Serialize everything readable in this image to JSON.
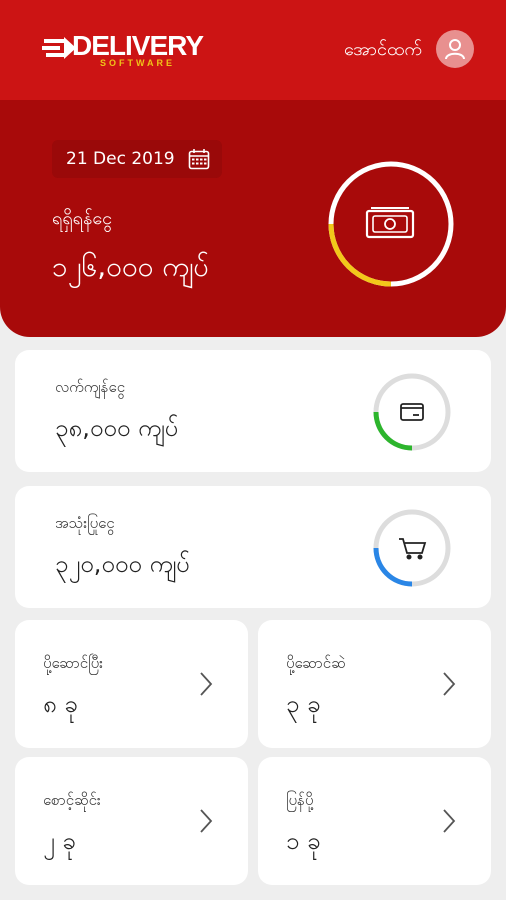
{
  "header": {
    "logo_text": "DELIVERY",
    "logo_sub": "SOFTWARE",
    "user_name": "အောင်ထက်",
    "icons": [
      "logo-arrow-icon",
      "user-icon"
    ]
  },
  "summary": {
    "date": "21 Dec 2019",
    "label": "ရရှိရန်ငွေ",
    "amount": "၁၂၆,၀၀၀ ကျပ်",
    "icons": [
      "calendar-icon",
      "money-icon"
    ]
  },
  "balance": {
    "label": "လက်ကျန်ငွေ",
    "amount": "၃၈,၀၀၀ ကျပ်",
    "progress": 0.25,
    "icon": "card-icon"
  },
  "spent": {
    "label": "အသုံးပြုငွေ",
    "amount": "၃၂၀,၀၀၀ ကျပ်",
    "progress": 0.25,
    "icon": "cart-icon"
  },
  "stats": [
    {
      "label": "ပို့ဆောင်ပြီး",
      "count": "၈ ခု"
    },
    {
      "label": "ပို့ဆောင်ဆဲ",
      "count": "၃ ခု"
    },
    {
      "label": "စောင့်ဆိုင်း",
      "count": "၂ ခု"
    },
    {
      "label": "ပြန်ပို့",
      "count": "၁ ခု"
    }
  ],
  "colors": {
    "header_red": "#cc1414",
    "hero_red": "#a80a0a",
    "ring_yellow": "#f2c81a",
    "ring_green": "#2db52d",
    "ring_blue": "#2a86e6"
  }
}
